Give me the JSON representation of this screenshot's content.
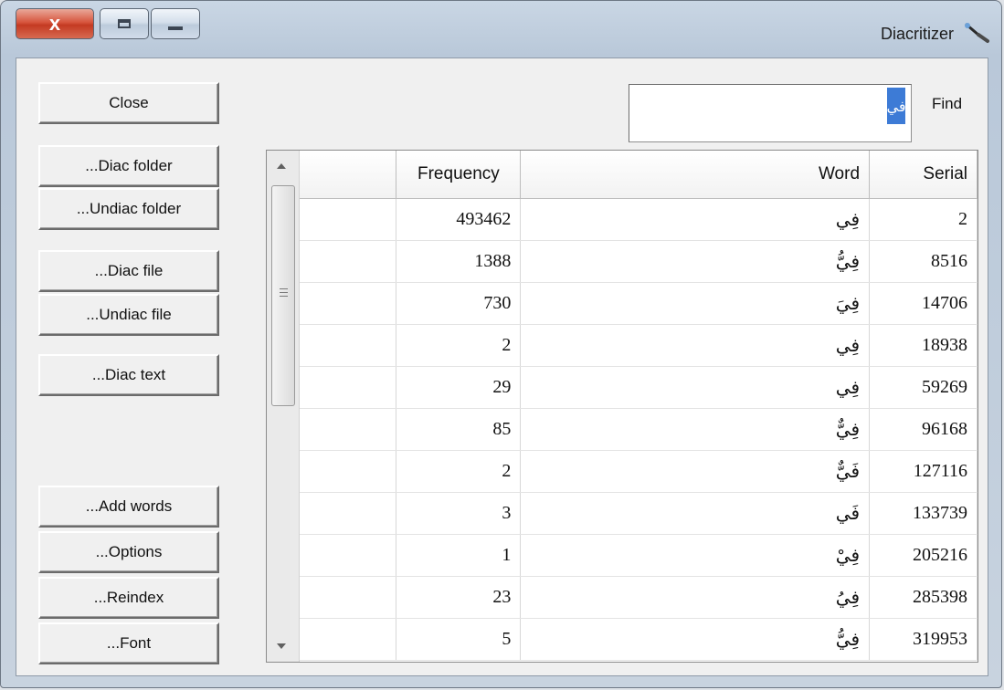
{
  "window": {
    "title": "Diacritizer",
    "close_glyph": "x"
  },
  "buttons": {
    "close": "Close",
    "diac_folder": "...Diac folder",
    "undiac_folder": "...Undiac folder",
    "diac_file": "...Diac file",
    "undiac_file": "...Undiac file",
    "diac_text": "...Diac text",
    "add_words": "...Add words",
    "options": "...Options",
    "reindex": "...Reindex",
    "font": "...Font"
  },
  "find": {
    "label": "Find",
    "value": "في"
  },
  "table": {
    "columns": [
      "",
      "Frequency",
      "Word",
      "Serial"
    ],
    "rows": [
      {
        "frequency": "493462",
        "word": "فِي",
        "serial": "2"
      },
      {
        "frequency": "1388",
        "word": "فِيُّ",
        "serial": "8516"
      },
      {
        "frequency": "730",
        "word": "فِيَ",
        "serial": "14706"
      },
      {
        "frequency": "2",
        "word": "فِي",
        "serial": "18938"
      },
      {
        "frequency": "29",
        "word": "فِي",
        "serial": "59269"
      },
      {
        "frequency": "85",
        "word": "فِيٌّ",
        "serial": "96168"
      },
      {
        "frequency": "2",
        "word": "فَيٌّ",
        "serial": "127116"
      },
      {
        "frequency": "3",
        "word": "فَي",
        "serial": "133739"
      },
      {
        "frequency": "1",
        "word": "فِيْ",
        "serial": "205216"
      },
      {
        "frequency": "23",
        "word": "فِيُ",
        "serial": "285398"
      },
      {
        "frequency": "5",
        "word": "فِيُّ",
        "serial": "319953"
      }
    ]
  }
}
